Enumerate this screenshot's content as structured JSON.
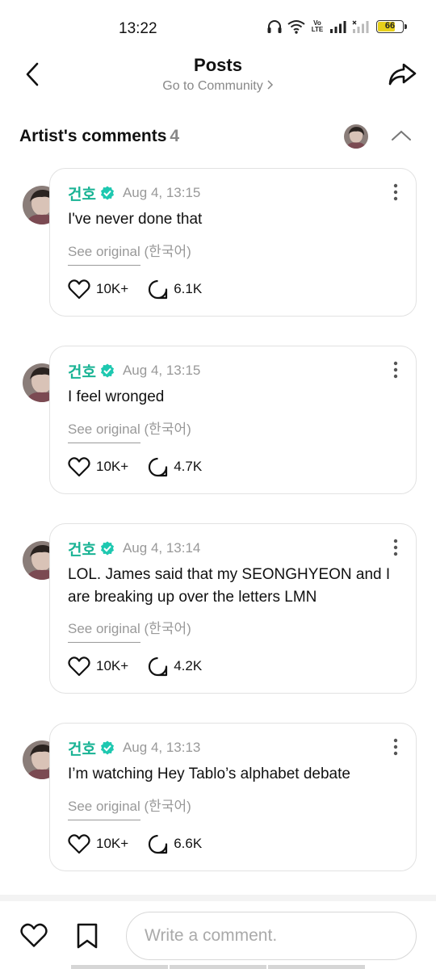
{
  "status_bar": {
    "time": "13:22",
    "network_label": "Vo\nLTE",
    "battery": "66",
    "icons": [
      "headphones-icon",
      "wifi-icon",
      "volte-icon",
      "signal-icon",
      "signal-no-service-icon",
      "battery-icon"
    ]
  },
  "header": {
    "title": "Posts",
    "community_link": "Go to Community",
    "back_icon": "chevron-left-icon",
    "share_icon": "share-icon"
  },
  "section": {
    "title": "Artist's comments",
    "count": "4",
    "collapse_icon": "chevron-up-icon"
  },
  "comments": [
    {
      "author": "건호",
      "date": "Aug 4, 13:15",
      "text": "I've never done that",
      "see_original": "See original",
      "language": "(한국어)",
      "likes": "10K+",
      "replies": "6.1K"
    },
    {
      "author": "건호",
      "date": "Aug 4, 13:15",
      "text": "I feel wronged",
      "see_original": "See original",
      "language": "(한국어)",
      "likes": "10K+",
      "replies": "4.7K"
    },
    {
      "author": "건호",
      "date": "Aug 4, 13:14",
      "text": "LOL. James said that my SEONGHYEON and I are breaking up over the letters LMN",
      "see_original": "See original",
      "language": "(한국어)",
      "likes": "10K+",
      "replies": "4.2K"
    },
    {
      "author": "건호",
      "date": "Aug 4, 13:13",
      "text": "I’m watching Hey Tablo’s alphabet debate",
      "see_original": "See original",
      "language": "(한국어)",
      "likes": "10K+",
      "replies": "6.6K"
    }
  ],
  "bottom_bar": {
    "comment_placeholder": "Write a comment.",
    "like_icon": "heart-icon",
    "bookmark_icon": "bookmark-icon"
  },
  "colors": {
    "author": "#19b394",
    "verified_badge": "#1ec8b0",
    "muted_text": "#999999",
    "card_border": "#e2e2e2"
  }
}
